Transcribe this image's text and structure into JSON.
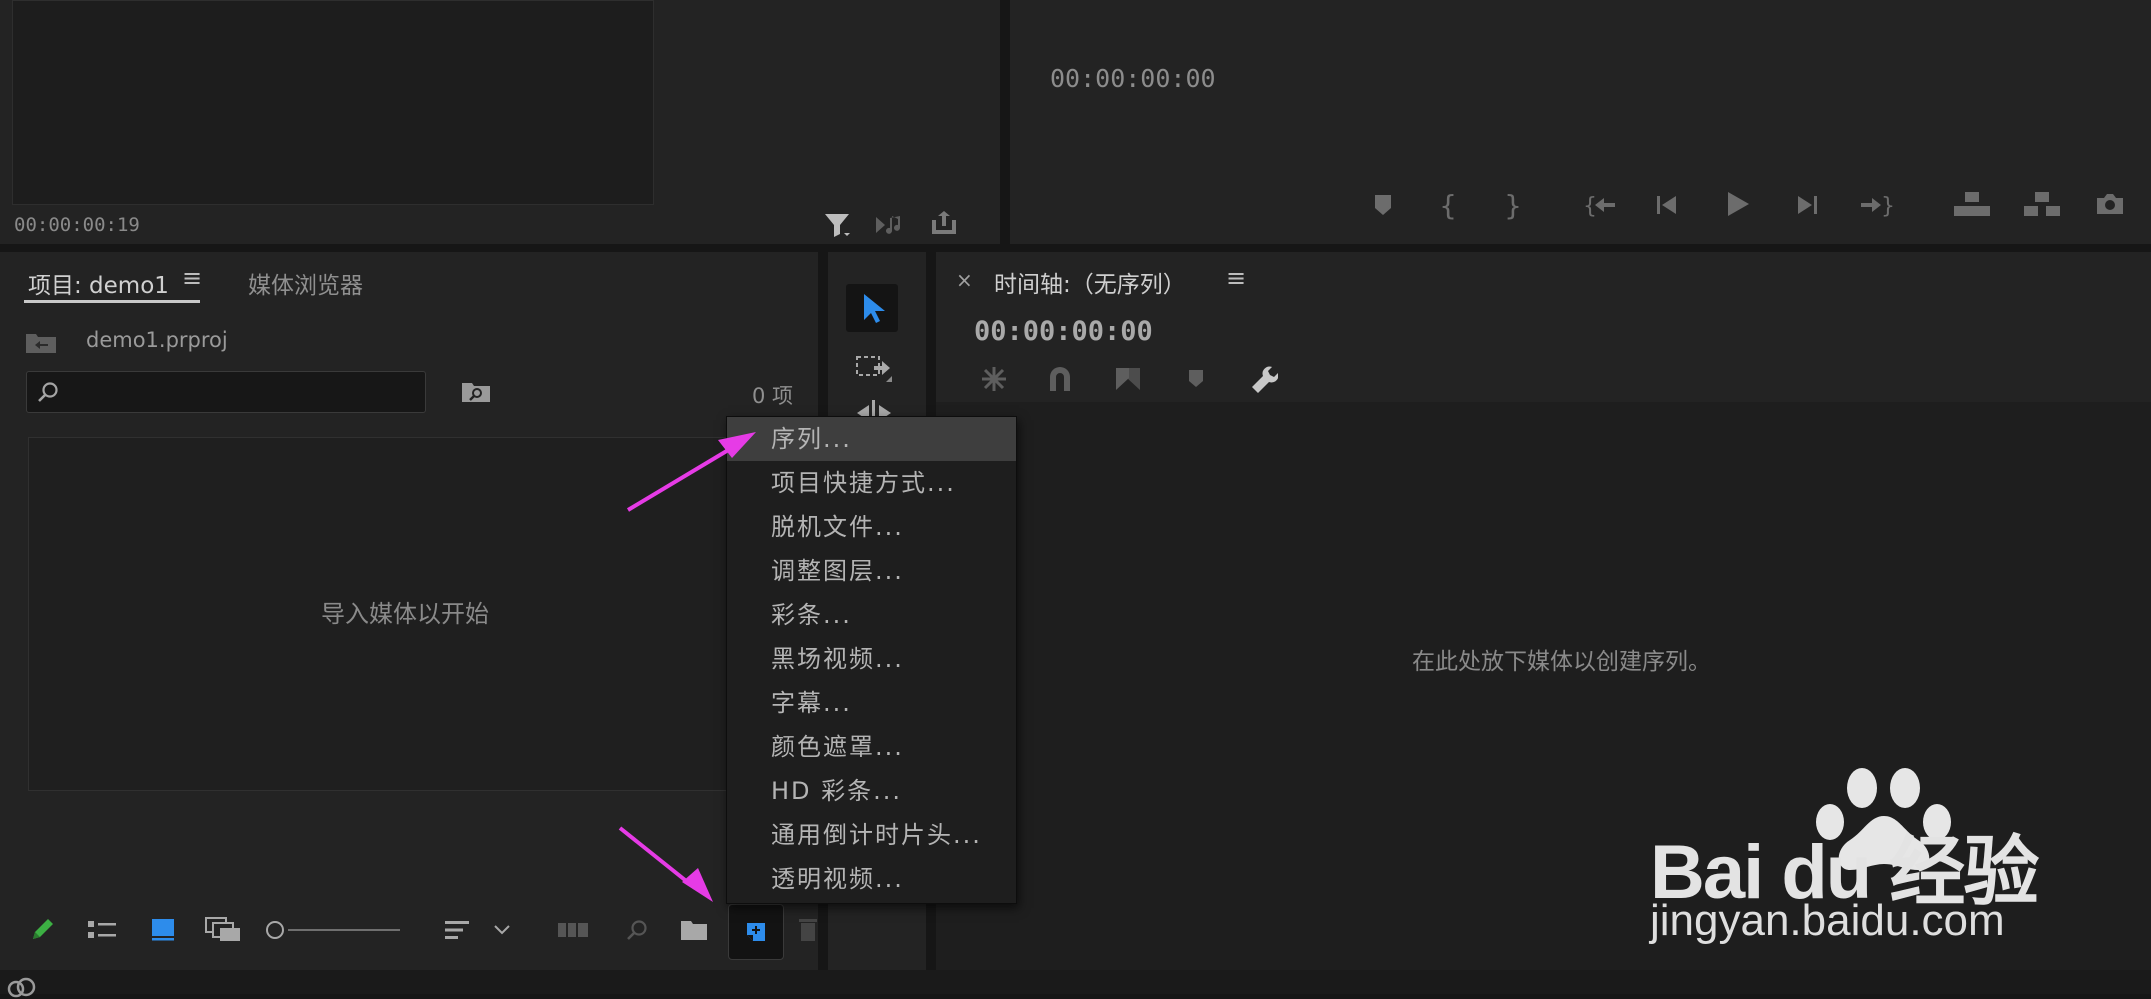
{
  "source_monitor": {
    "timecode": "00:00:00:19"
  },
  "program_monitor": {
    "timecode": "00:00:00:00"
  },
  "project_panel": {
    "tab_project": "项目: demo1",
    "tab_media_browser": "媒体浏览器",
    "filename": "demo1.prproj",
    "search_placeholder": "",
    "item_count": "0 项",
    "empty_message": "导入媒体以开始"
  },
  "new_item_menu": {
    "items": [
      {
        "label": "序列..."
      },
      {
        "label": "项目快捷方式..."
      },
      {
        "label": "脱机文件..."
      },
      {
        "label": "调整图层..."
      },
      {
        "label": "彩条..."
      },
      {
        "label": "黑场视频..."
      },
      {
        "label": "字幕..."
      },
      {
        "label": "颜色遮罩..."
      },
      {
        "label": "HD 彩条..."
      },
      {
        "label": "通用倒计时片头..."
      },
      {
        "label": "透明视频..."
      }
    ],
    "selected_index": 0
  },
  "timeline_panel": {
    "title": "时间轴:（无序列）",
    "timecode": "00:00:00:00",
    "empty_message": "在此处放下媒体以创建序列。"
  },
  "watermark": {
    "brand": "Bai du 经验",
    "url": "jingyan.baidu.com"
  },
  "colors": {
    "accent_blue": "#2d8ceb",
    "annotation_arrow": "#e63be6",
    "pen_green": "#3cb043"
  }
}
